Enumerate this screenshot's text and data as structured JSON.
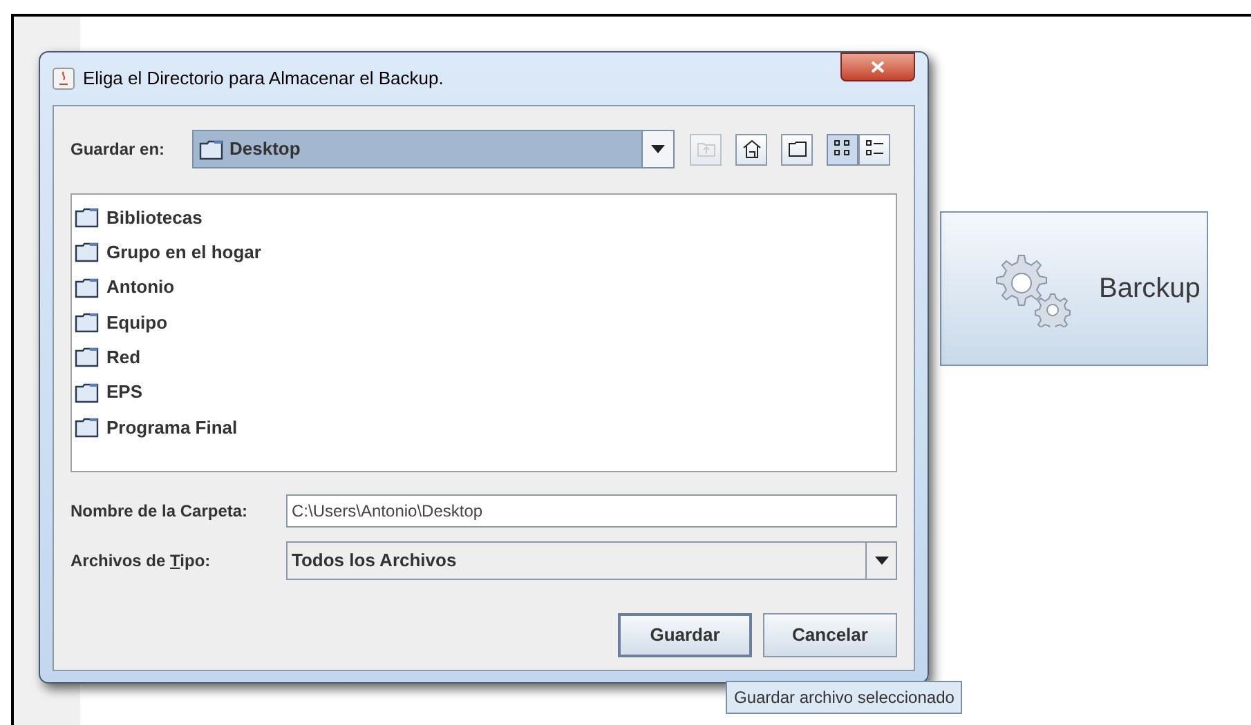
{
  "dialog": {
    "title": "Eliga el Directorio para Almacenar el Backup.",
    "look_in": {
      "label": "Guardar en:",
      "value": "Desktop"
    },
    "toolbar": [
      {
        "kind": "up",
        "disabled": true,
        "selected": false
      },
      {
        "kind": "home",
        "disabled": false,
        "selected": false
      },
      {
        "kind": "new-folder",
        "disabled": false,
        "selected": false
      },
      {
        "kind": "list",
        "disabled": false,
        "selected": true
      },
      {
        "kind": "details",
        "disabled": false,
        "selected": false
      }
    ],
    "files": [
      {
        "name": "Bibliotecas"
      },
      {
        "name": "Grupo en el hogar"
      },
      {
        "name": "Antonio"
      },
      {
        "name": "Equipo"
      },
      {
        "name": "Red"
      },
      {
        "name": "EPS"
      },
      {
        "name": "Programa Final"
      }
    ],
    "folder_name": {
      "label": "Nombre de la Carpeta:",
      "value": "C:\\Users\\Antonio\\Desktop"
    },
    "file_type": {
      "label_before": "Archivos de ",
      "mnemonic": "T",
      "label_after": "ipo:",
      "value": "Todos los Archivos"
    },
    "buttons": [
      {
        "label": "Guardar",
        "default": true
      },
      {
        "label": "Cancelar",
        "default": false
      }
    ]
  },
  "tooltip": "Guardar archivo seleccionado",
  "backup_button": {
    "label": "Barckup"
  }
}
